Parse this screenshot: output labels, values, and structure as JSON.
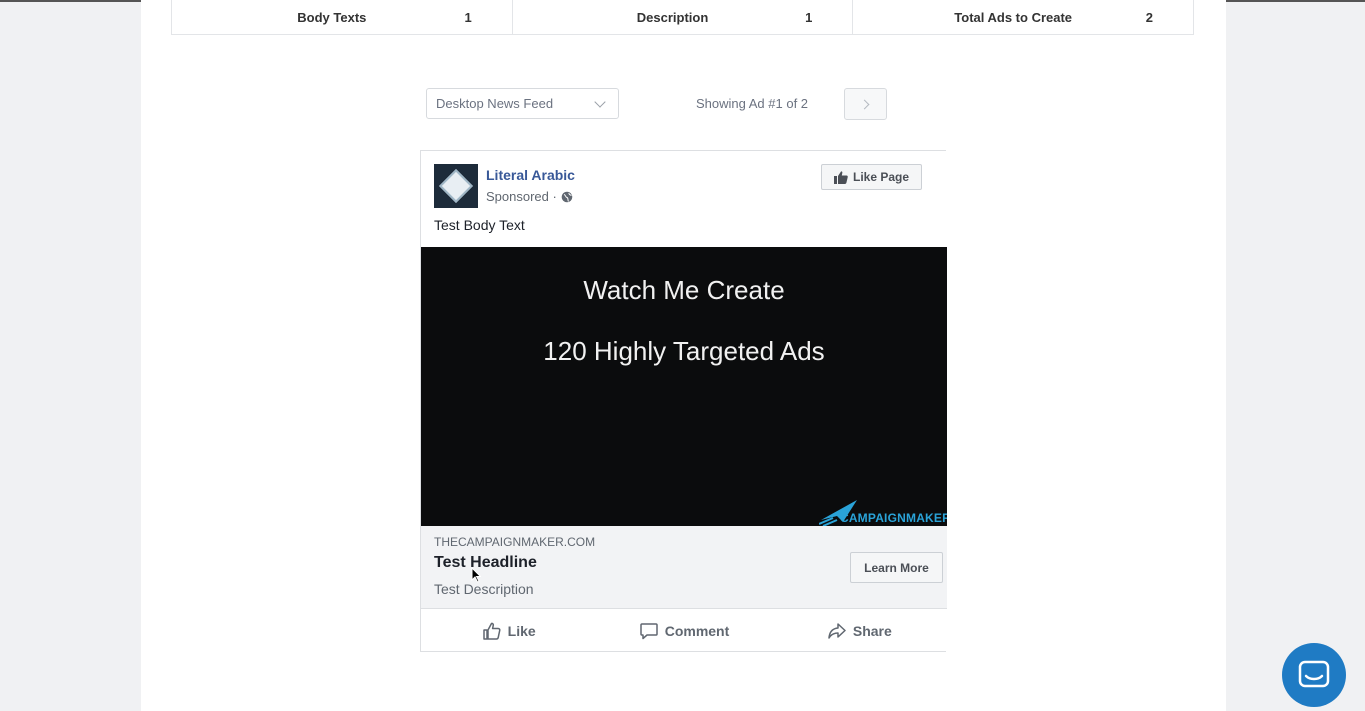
{
  "stats": [
    {
      "label": "Body Texts",
      "value": "1"
    },
    {
      "label": "Description",
      "value": "1"
    },
    {
      "label": "Total Ads to Create",
      "value": "2"
    }
  ],
  "controls": {
    "placement_selected": "Desktop News Feed",
    "showing_text": "Showing Ad #1 of 2"
  },
  "ad": {
    "page_name": "Literal Arabic",
    "sponsored": "Sponsored ·",
    "like_page_label": "Like Page",
    "body_text": "Test Body Text",
    "media_line1": "Watch Me Create",
    "media_line2": "120 Highly Targeted Ads",
    "brand_text": "CAMPAIGNMAKER",
    "domain": "THECAMPAIGNMAKER.COM",
    "headline": "Test Headline",
    "description": "Test Description",
    "cta_label": "Learn More",
    "actions": {
      "like": "Like",
      "comment": "Comment",
      "share": "Share"
    }
  },
  "colors": {
    "page_name": "#385898",
    "chat_button": "#1f7bc4",
    "media_bg": "#0b0c0d"
  },
  "icons": [
    "thumbs-up-icon",
    "globe-icon",
    "chevron-down-icon",
    "chevron-right-icon",
    "comment-icon",
    "share-icon",
    "chat-icon",
    "cursor-icon"
  ]
}
